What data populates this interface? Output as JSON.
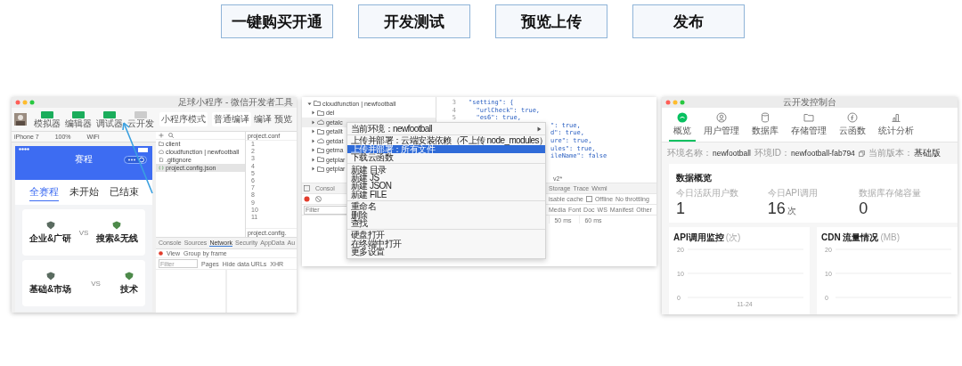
{
  "steps": [
    {
      "label": "一键购买开通"
    },
    {
      "label": "开发测试"
    },
    {
      "label": "预览上传"
    },
    {
      "label": "发布"
    }
  ],
  "devtools": {
    "title": "足球小程序 - 微信开发者工具",
    "tools": [
      {
        "label": "模拟器",
        "selected": true
      },
      {
        "label": "编辑器",
        "selected": true
      },
      {
        "label": "调试器",
        "selected": true
      },
      {
        "label": "云开发",
        "selected": false
      }
    ],
    "mode": "小程序模式",
    "compile": "普通编译",
    "actions": [
      {
        "label": "编译"
      },
      {
        "label": "预览"
      }
    ],
    "device": "iPhone 7",
    "zoom": "100%",
    "network": "WiFi",
    "phone": {
      "title": "赛程",
      "tabs": [
        {
          "label": "全赛程",
          "selected": true
        },
        {
          "label": "未开始",
          "selected": false
        },
        {
          "label": "已结束",
          "selected": false
        }
      ],
      "matches": [
        {
          "home": "企业&广研",
          "vs": "VS",
          "away": "搜索&无线"
        },
        {
          "home": "基础&市场",
          "vs": "VS",
          "away": "技术"
        }
      ]
    },
    "files": [
      {
        "name": "client",
        "kind": "folder",
        "selected": false
      },
      {
        "name": "cloudfunction | newfootball",
        "kind": "cloud",
        "selected": false
      },
      {
        "name": ".gitignore",
        "kind": "file",
        "selected": false
      },
      {
        "name": "project.config.json",
        "kind": "json",
        "selected": true
      }
    ],
    "editor_tab": "project.conf",
    "line_numbers": [
      "1",
      "2",
      "3",
      "4",
      "5",
      "6",
      "7",
      "8",
      "9",
      "10",
      "11"
    ],
    "editor_footer": "project.config.",
    "panel_tabs": [
      {
        "label": "Console",
        "selected": false
      },
      {
        "label": "Sources",
        "selected": false
      },
      {
        "label": "Network",
        "selected": true
      },
      {
        "label": "Security",
        "selected": false
      },
      {
        "label": "AppData",
        "selected": false
      },
      {
        "label": "Au",
        "selected": false
      }
    ],
    "options": [
      "View",
      "Group by frame"
    ],
    "filter_placeholder": "Filter",
    "filter_options": [
      "Pages",
      "Hide data URLs",
      "XHR"
    ]
  },
  "cloud": {
    "root": "cloudfunction | newfootball",
    "children": [
      {
        "name": "del",
        "kind": "folder",
        "selected": false
      },
      {
        "name": "getalc",
        "kind": "cloud",
        "selected": true
      },
      {
        "name": "getallt",
        "kind": "folder",
        "selected": false
      },
      {
        "name": "getdat",
        "kind": "cloud",
        "selected": false
      },
      {
        "name": "getma",
        "kind": "folder",
        "selected": false
      },
      {
        "name": "getplar",
        "kind": "folder",
        "selected": false
      },
      {
        "name": "getplar",
        "kind": "folder",
        "selected": false
      }
    ],
    "code": [
      {
        "number": "3",
        "text": "\"setting\": {"
      },
      {
        "number": "4",
        "text": "  \"urlCheck\": true,"
      },
      {
        "number": "5",
        "text": "  \"es6\": true,"
      },
      {
        "text": "\": true,"
      },
      {
        "text": "d\": true,"
      },
      {
        "text": "ure\": true,"
      },
      {
        "text": "ules\": true,"
      },
      {
        "text": "ileName\": false"
      }
    ],
    "menu": [
      {
        "items": [
          {
            "label": "当前环境：newfootball",
            "submenu": true,
            "selected": false
          }
        ]
      },
      {
        "items": [
          {
            "label": "上传并部署：云端安装依赖（不上传 node_modules）",
            "selected": false
          },
          {
            "label": "上传并部署：所有文件",
            "selected": true
          },
          {
            "label": "下载云函数",
            "selected": false
          }
        ]
      },
      {
        "items": [
          {
            "label": "新建 目录",
            "selected": false
          },
          {
            "label": "新建 JS",
            "selected": false
          },
          {
            "label": "新建 JSON",
            "selected": false
          },
          {
            "label": "新建 FILE",
            "selected": false
          }
        ]
      },
      {
        "items": [
          {
            "label": "重命名",
            "selected": false
          },
          {
            "label": "删除",
            "selected": false
          },
          {
            "label": "查找",
            "selected": false
          }
        ]
      },
      {
        "items": [
          {
            "label": "硬盘打开",
            "selected": false
          },
          {
            "label": "在终端中打开",
            "selected": false
          },
          {
            "label": "更多设置",
            "selected": false
          }
        ]
      }
    ],
    "branch": "v2*",
    "left_tab": "Consol",
    "tabs": [
      "Storage",
      "Trace",
      "Wxml"
    ],
    "cache": "isable cache",
    "offline": {
      "label": "Offline",
      "checked": false
    },
    "throttle": "No throttling",
    "filter_placeholder": "Filter",
    "types": [
      "Media",
      "Font",
      "Doc",
      "WS",
      "Manifest",
      "Other"
    ],
    "timeline": [
      "50 ms",
      "60 ms"
    ]
  },
  "console": {
    "title": "云开发控制台",
    "nav": [
      {
        "label": "概览",
        "selected": true
      },
      {
        "label": "用户管理",
        "selected": false
      },
      {
        "label": "数据库",
        "selected": false
      },
      {
        "label": "存储管理",
        "selected": false
      },
      {
        "label": "云函数",
        "selected": false
      },
      {
        "label": "统计分析",
        "selected": false
      }
    ],
    "env": [
      {
        "label": "环境名称：",
        "value": "newfootball"
      },
      {
        "label": "环境ID：",
        "value": "newfootball-fab794"
      },
      {
        "label": "当前版本：",
        "value": "基础版"
      }
    ],
    "overview_title": "数据概览",
    "stats": [
      {
        "label": "今日活跃用户数",
        "value": "1"
      },
      {
        "label": "今日API调用",
        "value": "16",
        "unit": "次"
      },
      {
        "label": "数据库存储容量",
        "value": "0"
      }
    ],
    "charts": [
      {
        "chart_data": {
          "type": "line",
          "title": "API调用监控",
          "ylabel": "(次)",
          "categories": [
            "11-24"
          ],
          "yticks": [
            0,
            10,
            20
          ],
          "ylim": [
            0,
            20
          ]
        }
      },
      {
        "chart_data": {
          "type": "line",
          "title": "CDN 流量情况",
          "ylabel": "(MB)",
          "categories": [
            null
          ],
          "yticks": [
            0,
            10,
            20
          ],
          "ylim": [
            0,
            20
          ]
        }
      }
    ]
  }
}
